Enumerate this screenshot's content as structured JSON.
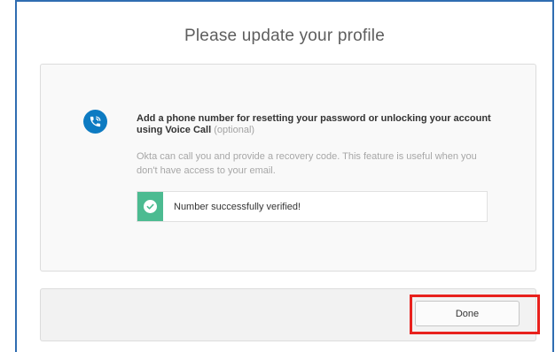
{
  "modal": {
    "title": "Please update your profile"
  },
  "phone_setup": {
    "icon": "phone-call-icon",
    "prompt": "Add a phone number for resetting your password or unlocking your account using Voice Call",
    "optional_label": "(optional)",
    "description": "Okta can call you and provide a recovery code. This feature is useful when you don't have access to your email."
  },
  "verification": {
    "icon": "checkmark-icon",
    "message": "Number successfully verified!",
    "status_color": "#4cbb91"
  },
  "footer": {
    "done_label": "Done"
  },
  "colors": {
    "accent": "#0d7bc2",
    "success": "#4cbb91",
    "highlight": "#e8211d"
  }
}
